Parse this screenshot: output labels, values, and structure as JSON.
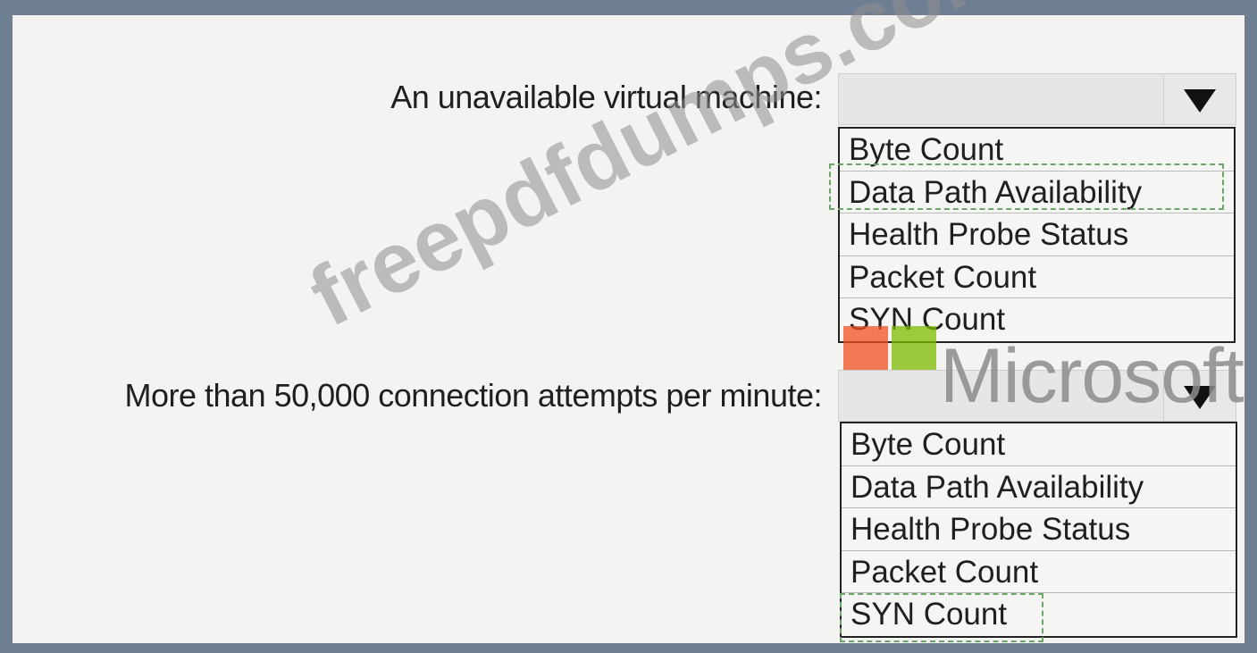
{
  "questions": [
    {
      "label": "An unavailable virtual machine:",
      "options": [
        "Byte Count",
        "Data Path Availability",
        "Health Probe Status",
        "Packet Count",
        "SYN Count"
      ],
      "selected": "Data Path Availability"
    },
    {
      "label": "More than 50,000 connection attempts per minute:",
      "options": [
        "Byte Count",
        "Data Path Availability",
        "Health Probe Status",
        "Packet Count",
        "SYN Count"
      ],
      "selected": "SYN Count"
    }
  ],
  "branding": {
    "microsoft_text": "Microsoft",
    "watermark_text": "freepdfdumps.com",
    "logo_colors": [
      "#f25022",
      "#7fba00",
      "#00a4ef",
      "#ffb900"
    ]
  },
  "icons": {
    "dropdown": "chevron-down-icon",
    "logo": "microsoft-logo-icon"
  },
  "colors": {
    "frame": "#6f7f93",
    "selection_outline": "#6aa56a"
  }
}
